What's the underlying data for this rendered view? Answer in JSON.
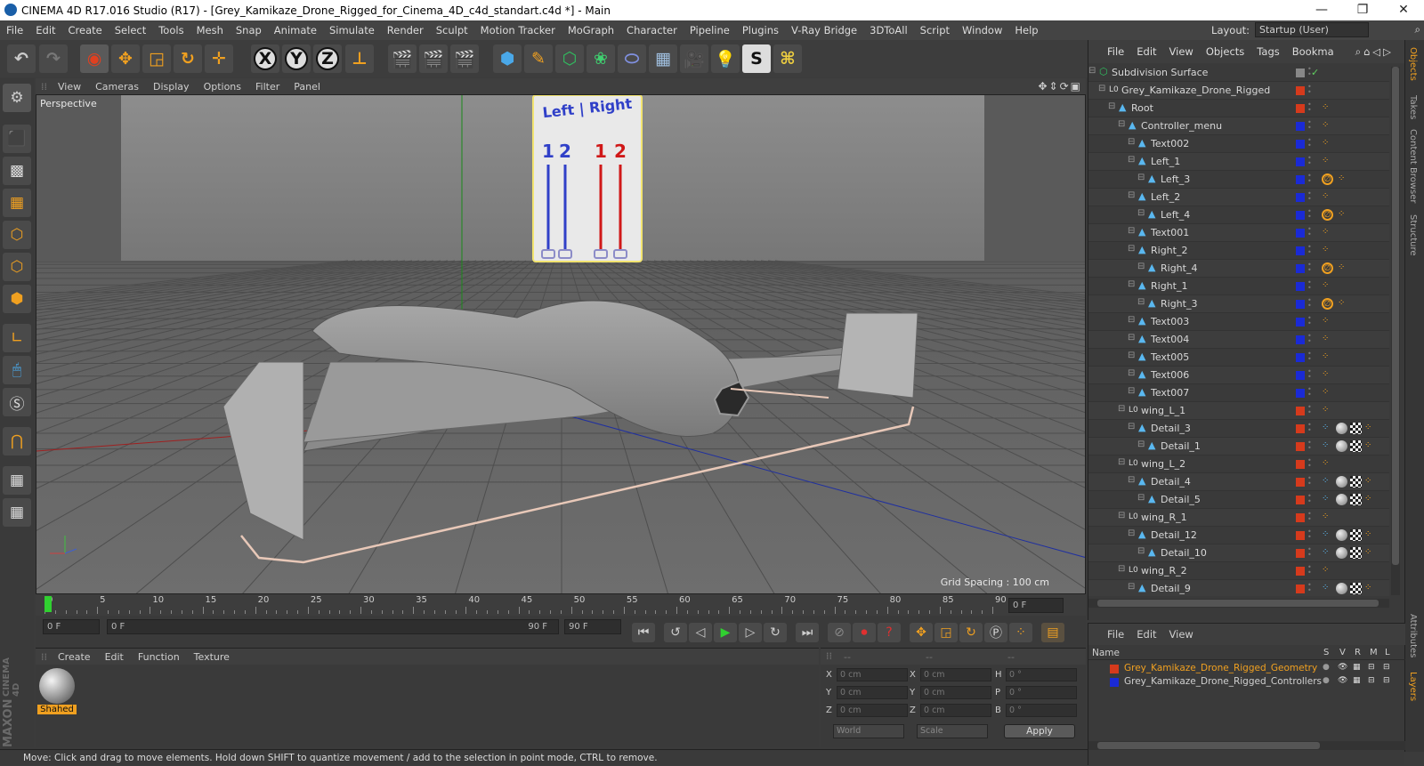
{
  "window": {
    "title": "CINEMA 4D R17.016 Studio (R17) - [Grey_Kamikaze_Drone_Rigged_for_Cinema_4D_c4d_standart.c4d *] - Main",
    "minimize": "—",
    "maximize": "❐",
    "close": "✕"
  },
  "menubar": {
    "items": [
      "File",
      "Edit",
      "Create",
      "Select",
      "Tools",
      "Mesh",
      "Snap",
      "Animate",
      "Simulate",
      "Render",
      "Sculpt",
      "Motion Tracker",
      "MoGraph",
      "Character",
      "Pipeline",
      "Plugins",
      "V-Ray Bridge",
      "3DToAll",
      "Script",
      "Window",
      "Help"
    ],
    "layout_label": "Layout:",
    "layout_value": "Startup (User)"
  },
  "toolbar": {
    "axis_x": "X",
    "axis_y": "Y",
    "axis_z": "Z"
  },
  "viewport": {
    "menu": [
      "View",
      "Cameras",
      "Display",
      "Options",
      "Filter",
      "Panel"
    ],
    "camera_label": "Perspective",
    "grid_spacing": "Grid Spacing : 100 cm",
    "controller_title": "Left | Right",
    "slider_labels": [
      "1",
      "2",
      "1",
      "2"
    ],
    "slider_colors": [
      "#3040c8",
      "#3040c8",
      "#d01818",
      "#d01818"
    ]
  },
  "timeline": {
    "ticks": [
      "0",
      "5",
      "10",
      "15",
      "20",
      "25",
      "30",
      "35",
      "40",
      "45",
      "50",
      "55",
      "60",
      "65",
      "70",
      "75",
      "80",
      "85",
      "90"
    ],
    "current_frame": "0 F"
  },
  "transport": {
    "start_field": "0 F",
    "range_start": "0 F",
    "range_end": "90 F",
    "end_field": "90 F"
  },
  "material_panel": {
    "menu": [
      "Create",
      "Edit",
      "Function",
      "Texture"
    ],
    "material_name": "Shahed",
    "brand_line1": "MAXON",
    "brand_line2": "CINEMA 4D"
  },
  "coord_panel": {
    "headers": [
      "--",
      "--",
      "--"
    ],
    "rows": [
      {
        "a": "X",
        "av": "0 cm",
        "b": "X",
        "bv": "0 cm",
        "c": "H",
        "cv": "0 °"
      },
      {
        "a": "Y",
        "av": "0 cm",
        "b": "Y",
        "bv": "0 cm",
        "c": "P",
        "cv": "0 °"
      },
      {
        "a": "Z",
        "av": "0 cm",
        "b": "Z",
        "bv": "0 cm",
        "c": "B",
        "cv": "0 °"
      }
    ],
    "world": "World",
    "scale": "Scale",
    "apply": "Apply"
  },
  "status": "Move: Click and drag to move elements. Hold down SHIFT to quantize movement / add to the selection in point mode, CTRL to remove.",
  "objects_panel": {
    "menu": [
      "File",
      "Edit",
      "View",
      "Objects",
      "Tags",
      "Bookma"
    ],
    "rows": [
      {
        "name": "Subdivision Surface",
        "depth": 0,
        "icon": "subdivision",
        "color": "#888888",
        "tag": "check"
      },
      {
        "name": "Grey_Kamikaze_Drone_Rigged",
        "depth": 1,
        "icon": "null",
        "color": "#d63a1c",
        "tag": ""
      },
      {
        "name": "Root",
        "depth": 2,
        "icon": "joint",
        "color": "#d63a1c",
        "tag": "dots"
      },
      {
        "name": "Controller_menu",
        "depth": 3,
        "icon": "joint",
        "color": "#1a2ad6",
        "tag": "dots"
      },
      {
        "name": "Text002",
        "depth": 4,
        "icon": "joint",
        "color": "#1a2ad6",
        "tag": "dots"
      },
      {
        "name": "Left_1",
        "depth": 4,
        "icon": "joint",
        "color": "#1a2ad6",
        "tag": "dots"
      },
      {
        "name": "Left_3",
        "depth": 5,
        "icon": "joint",
        "color": "#1a2ad6",
        "tag": "block"
      },
      {
        "name": "Left_2",
        "depth": 4,
        "icon": "joint",
        "color": "#1a2ad6",
        "tag": "dots"
      },
      {
        "name": "Left_4",
        "depth": 5,
        "icon": "joint",
        "color": "#1a2ad6",
        "tag": "block"
      },
      {
        "name": "Text001",
        "depth": 4,
        "icon": "joint",
        "color": "#1a2ad6",
        "tag": "dots"
      },
      {
        "name": "Right_2",
        "depth": 4,
        "icon": "joint",
        "color": "#1a2ad6",
        "tag": "dots"
      },
      {
        "name": "Right_4",
        "depth": 5,
        "icon": "joint",
        "color": "#1a2ad6",
        "tag": "block"
      },
      {
        "name": "Right_1",
        "depth": 4,
        "icon": "joint",
        "color": "#1a2ad6",
        "tag": "dots"
      },
      {
        "name": "Right_3",
        "depth": 5,
        "icon": "joint",
        "color": "#1a2ad6",
        "tag": "block"
      },
      {
        "name": "Text003",
        "depth": 4,
        "icon": "joint",
        "color": "#1a2ad6",
        "tag": "dots"
      },
      {
        "name": "Text004",
        "depth": 4,
        "icon": "joint",
        "color": "#1a2ad6",
        "tag": "dots"
      },
      {
        "name": "Text005",
        "depth": 4,
        "icon": "joint",
        "color": "#1a2ad6",
        "tag": "dots"
      },
      {
        "name": "Text006",
        "depth": 4,
        "icon": "joint",
        "color": "#1a2ad6",
        "tag": "dots"
      },
      {
        "name": "Text007",
        "depth": 4,
        "icon": "joint",
        "color": "#1a2ad6",
        "tag": "dots"
      },
      {
        "name": "wing_L_1",
        "depth": 3,
        "icon": "null",
        "color": "#d63a1c",
        "tag": "dots"
      },
      {
        "name": "Detail_3",
        "depth": 4,
        "icon": "joint",
        "color": "#d63a1c",
        "tag": "mat"
      },
      {
        "name": "Detail_1",
        "depth": 5,
        "icon": "joint",
        "color": "#d63a1c",
        "tag": "mat"
      },
      {
        "name": "wing_L_2",
        "depth": 3,
        "icon": "null",
        "color": "#d63a1c",
        "tag": "dots"
      },
      {
        "name": "Detail_4",
        "depth": 4,
        "icon": "joint",
        "color": "#d63a1c",
        "tag": "mat"
      },
      {
        "name": "Detail_5",
        "depth": 5,
        "icon": "joint",
        "color": "#d63a1c",
        "tag": "mat"
      },
      {
        "name": "wing_R_1",
        "depth": 3,
        "icon": "null",
        "color": "#d63a1c",
        "tag": "dots"
      },
      {
        "name": "Detail_12",
        "depth": 4,
        "icon": "joint",
        "color": "#d63a1c",
        "tag": "mat"
      },
      {
        "name": "Detail_10",
        "depth": 5,
        "icon": "joint",
        "color": "#d63a1c",
        "tag": "mat"
      },
      {
        "name": "wing_R_2",
        "depth": 3,
        "icon": "null",
        "color": "#d63a1c",
        "tag": "dots"
      },
      {
        "name": "Detail_9",
        "depth": 4,
        "icon": "joint",
        "color": "#d63a1c",
        "tag": "mat"
      }
    ]
  },
  "layers_panel": {
    "menu": [
      "File",
      "Edit",
      "View"
    ],
    "name_header": "Name",
    "col_headers": [
      "S",
      "V",
      "R",
      "M",
      "L"
    ],
    "layers": [
      {
        "name": "Grey_Kamikaze_Drone_Rigged_Geometry",
        "color": "#d63a1c",
        "text_color": "#f0a020"
      },
      {
        "name": "Grey_Kamikaze_Drone_Rigged_Controllers",
        "color": "#1a2ad6",
        "text_color": "#d0d0d0"
      }
    ]
  },
  "side_tabs": [
    "Objects",
    "Takes",
    "Content Browser",
    "Structure"
  ],
  "side_tabs_bottom": [
    "Attributes",
    "Layers"
  ]
}
